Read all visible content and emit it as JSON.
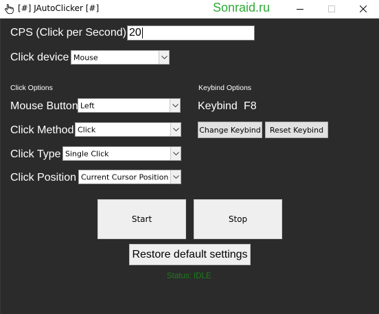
{
  "window": {
    "title": "[#] JAutoClicker [#]",
    "watermark": "Sonraid.ru",
    "app_icon": "hand-cursor-icon"
  },
  "cps": {
    "label": "CPS (Click per Second)",
    "value": "20"
  },
  "click_device": {
    "label": "Click device",
    "selected": "Mouse"
  },
  "click_options": {
    "heading": "Click Options",
    "mouse_button": {
      "label": "Mouse Button",
      "selected": "Left"
    },
    "click_method": {
      "label": "Click Method",
      "selected": "Click"
    },
    "click_type": {
      "label": "Click Type",
      "selected": "Single Click"
    },
    "click_position": {
      "label": "Click Position",
      "selected": "Current Cursor Position"
    }
  },
  "keybind_options": {
    "heading": "Keybind Options",
    "label": "Keybind",
    "key": "F8",
    "change_label": "Change Keybind",
    "reset_label": "Reset Keybind"
  },
  "actions": {
    "start_label": "Start",
    "stop_label": "Stop",
    "restore_label": "Restore default settings"
  },
  "status": {
    "text": "Status: IDLE",
    "color": "#1d7d1d"
  },
  "colors": {
    "background": "#2b2b2b",
    "watermark": "#2eaa36"
  }
}
